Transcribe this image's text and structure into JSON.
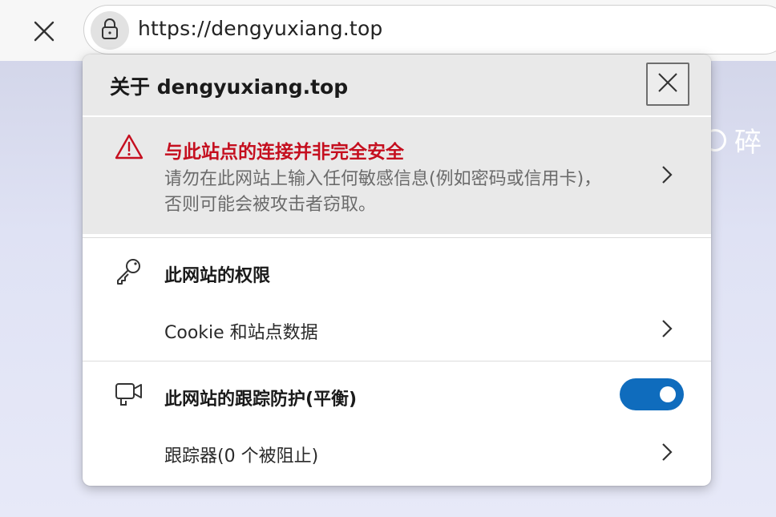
{
  "address_bar": {
    "url": "https://dengyuxiang.top"
  },
  "background_page": {
    "text_fragment": "碎"
  },
  "popup": {
    "title": "关于 dengyuxiang.top",
    "security_warning": {
      "title": "与此站点的连接并非完全安全",
      "description": "请勿在此网站上输入任何敏感信息(例如密码或信用卡)，否则可能会被攻击者窃取。",
      "icon": "warning-triangle-icon",
      "color": "#c50f1f"
    },
    "permissions": {
      "heading": "此网站的权限",
      "icon": "key-icon",
      "items": [
        {
          "label": "Cookie 和站点数据"
        }
      ]
    },
    "tracking": {
      "heading": "此网站的跟踪防护(平衡)",
      "icon": "camera-tracking-icon",
      "toggle_on": true,
      "toggle_color": "#0f6cbd",
      "items": [
        {
          "label": "跟踪器(0 个被阻止)"
        }
      ]
    }
  }
}
